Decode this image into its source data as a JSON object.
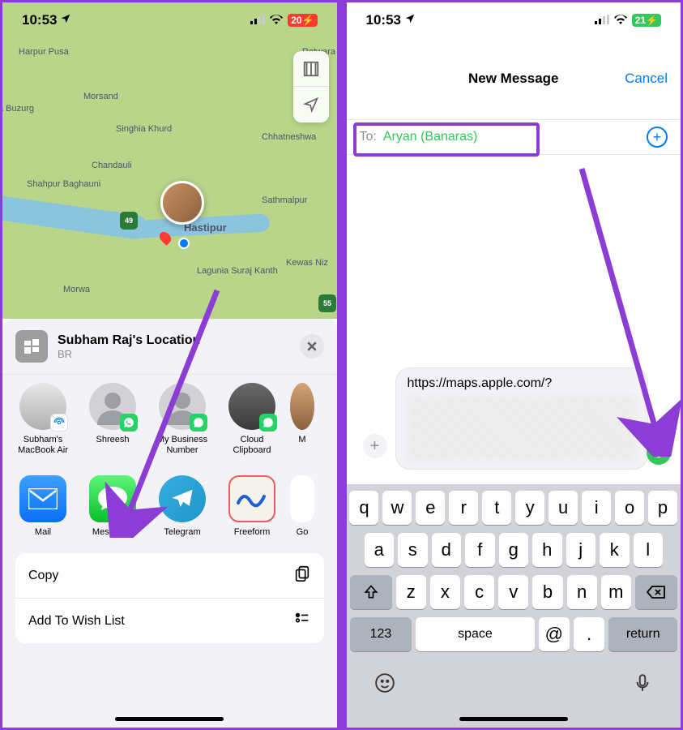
{
  "phone1": {
    "status": {
      "time": "10:53",
      "battery": "20",
      "locArrow": "↗"
    },
    "map": {
      "labels": [
        "Harpur Pusa",
        "Morsand",
        "Singhia Khurd",
        "Chandauli",
        "Shahpur Baghauni",
        "Sathmalpur",
        "Lagunia Suraj Kanth",
        "Morwa",
        "Kewas Niz",
        "Hastipur",
        "Chhatneshwa",
        "a Buzurg",
        "Ratwara"
      ],
      "routes": [
        "49",
        "55"
      ]
    },
    "share": {
      "title": "Subham Raj's Location",
      "subtitle": "BR",
      "contacts": [
        {
          "name": "Subham's MacBook Air",
          "type": "mac"
        },
        {
          "name": "Shreesh",
          "type": "wa"
        },
        {
          "name": "My Business Number",
          "type": "wa"
        },
        {
          "name": "Cloud Clipboard",
          "type": "wa"
        },
        {
          "name": "M",
          "type": "wa"
        }
      ],
      "apps": [
        {
          "name": "Mail",
          "cls": "mail"
        },
        {
          "name": "Messages",
          "cls": "messages"
        },
        {
          "name": "Telegram",
          "cls": "telegram"
        },
        {
          "name": "Freeform",
          "cls": "freeform"
        },
        {
          "name": "Go",
          "cls": ""
        }
      ],
      "actions": [
        "Copy",
        "Add To Wish List"
      ]
    }
  },
  "phone2": {
    "status": {
      "time": "10:53",
      "battery": "21"
    },
    "header": {
      "title": "New Message",
      "cancel": "Cancel"
    },
    "compose": {
      "toLabel": "To:",
      "recipient": "Aryan (Banaras)",
      "link": "https://maps.apple.com/?"
    },
    "keyboard": {
      "row1": [
        "q",
        "w",
        "e",
        "r",
        "t",
        "y",
        "u",
        "i",
        "o",
        "p"
      ],
      "row2": [
        "a",
        "s",
        "d",
        "f",
        "g",
        "h",
        "j",
        "k",
        "l"
      ],
      "row3": [
        "z",
        "x",
        "c",
        "v",
        "b",
        "n",
        "m"
      ],
      "numKey": "123",
      "space": "space",
      "at": "@",
      "dot": ".",
      "ret": "return"
    }
  }
}
